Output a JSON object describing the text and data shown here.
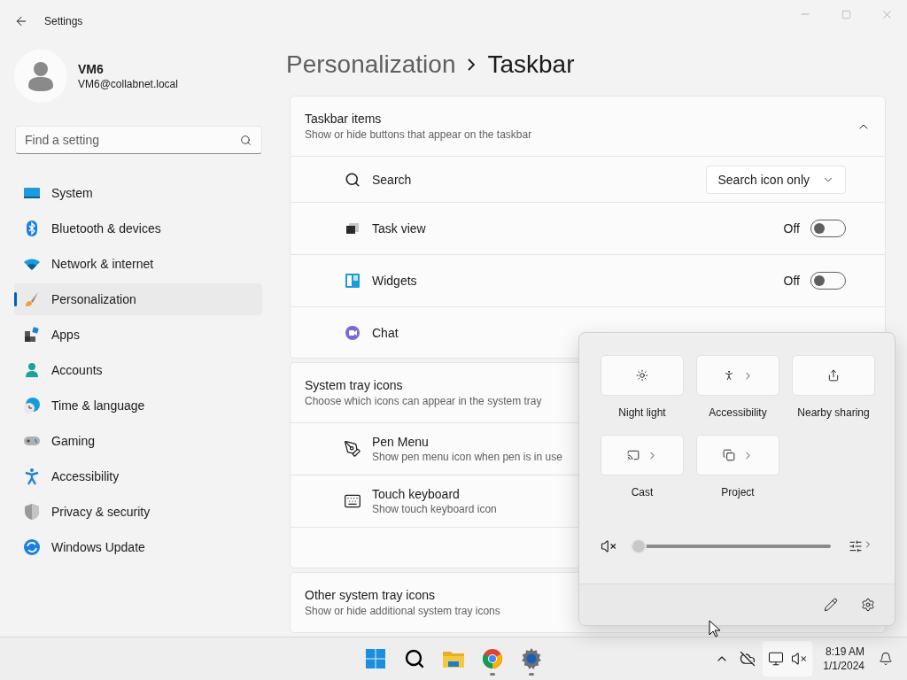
{
  "window": {
    "title": "Settings"
  },
  "profile": {
    "name": "VM6",
    "email": "VM6@collabnet.local"
  },
  "search": {
    "placeholder": "Find a setting"
  },
  "nav": [
    {
      "label": "System",
      "selected": false
    },
    {
      "label": "Bluetooth & devices",
      "selected": false
    },
    {
      "label": "Network & internet",
      "selected": false
    },
    {
      "label": "Personalization",
      "selected": true
    },
    {
      "label": "Apps",
      "selected": false
    },
    {
      "label": "Accounts",
      "selected": false
    },
    {
      "label": "Time & language",
      "selected": false
    },
    {
      "label": "Gaming",
      "selected": false
    },
    {
      "label": "Accessibility",
      "selected": false
    },
    {
      "label": "Privacy & security",
      "selected": false
    },
    {
      "label": "Windows Update",
      "selected": false
    }
  ],
  "breadcrumb": {
    "parent": "Personalization",
    "current": "Taskbar"
  },
  "sections": [
    {
      "title": "Taskbar items",
      "subtitle": "Show or hide buttons that appear on the taskbar",
      "expanded": true,
      "rows": [
        {
          "kind": "dropdown",
          "label": "Search",
          "value": "Search icon only"
        },
        {
          "kind": "toggle",
          "label": "Task view",
          "state_text": "Off",
          "on": false
        },
        {
          "kind": "toggle",
          "label": "Widgets",
          "state_text": "Off",
          "on": false
        },
        {
          "kind": "plain",
          "label": "Chat"
        }
      ]
    },
    {
      "title": "System tray icons",
      "subtitle": "Choose which icons can appear in the system tray",
      "rows": [
        {
          "kind": "plain",
          "label": "Pen Menu",
          "description": "Show pen menu icon when pen is in use"
        },
        {
          "kind": "plain",
          "label": "Touch keyboard",
          "description": "Show touch keyboard icon"
        },
        {
          "kind": "blank"
        }
      ]
    },
    {
      "title": "Other system tray icons",
      "subtitle": "Show or hide additional system tray icons"
    }
  ],
  "quick_settings": {
    "tiles": [
      {
        "label": "Night light",
        "on": false,
        "expandable": false
      },
      {
        "label": "Accessibility",
        "on": false,
        "expandable": true
      },
      {
        "label": "Nearby sharing",
        "on": false,
        "expandable": false
      },
      {
        "label": "Cast",
        "on": false,
        "expandable": true
      },
      {
        "label": "Project",
        "on": false,
        "expandable": true
      }
    ],
    "volume": {
      "muted": true,
      "level": 0
    }
  },
  "taskbar": {
    "apps": [
      {
        "running": false
      },
      {
        "running": false
      },
      {
        "running": false
      },
      {
        "running": true
      },
      {
        "running": true
      }
    ],
    "clock": {
      "time": "8:19 AM",
      "date": "1/1/2024"
    }
  }
}
